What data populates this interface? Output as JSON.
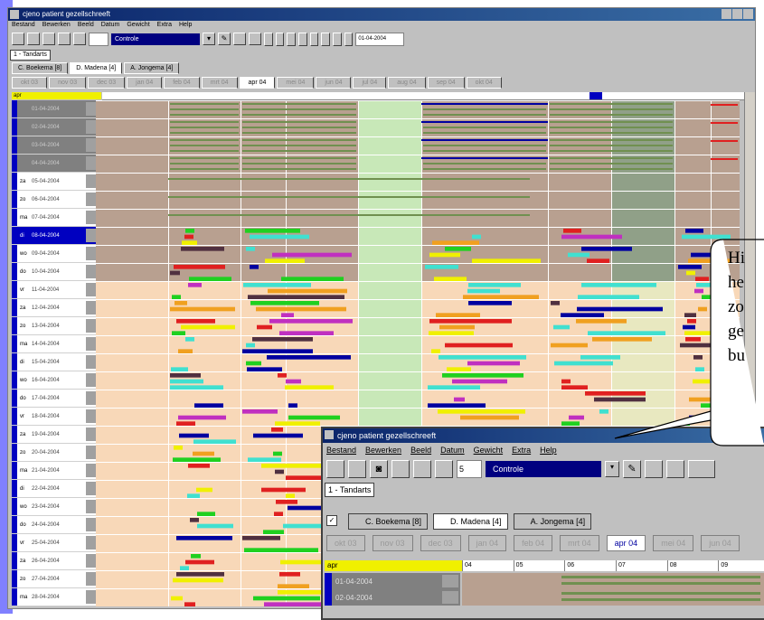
{
  "main": {
    "title": "cjeno patient gezellschreeft",
    "menu": [
      "Bestand",
      "Bewerken",
      "Beeld",
      "Datum",
      "Gewicht",
      "Extra",
      "Help"
    ],
    "combo_value": "Controle",
    "date_value": "01-04-2004",
    "view_tab": "1 - Tandarts",
    "staff_tabs": [
      {
        "label": "C. Boekema [8]",
        "active": false
      },
      {
        "label": "D. Madena [4]",
        "active": true
      },
      {
        "label": "A. Jongema [4]",
        "active": false
      }
    ],
    "months": [
      {
        "label": "okt 03",
        "active": false
      },
      {
        "label": "nov 03",
        "active": false
      },
      {
        "label": "dec 03",
        "active": false
      },
      {
        "label": "jan 04",
        "active": false
      },
      {
        "label": "feb 04",
        "active": false
      },
      {
        "label": "mrt 04",
        "active": false
      },
      {
        "label": "apr 04",
        "active": true
      },
      {
        "label": "mei 04",
        "active": false
      },
      {
        "label": "jun 04",
        "active": false
      },
      {
        "label": "jul 04",
        "active": false
      },
      {
        "label": "aug 04",
        "active": false
      },
      {
        "label": "sep 04",
        "active": false
      },
      {
        "label": "okt 04",
        "active": false
      }
    ],
    "month_header": "apr",
    "rows": [
      {
        "day": "",
        "date": "01-04-2004"
      },
      {
        "day": "",
        "date": "02-04-2004"
      },
      {
        "day": "",
        "date": "03-04-2004"
      },
      {
        "day": "",
        "date": "04-04-2004"
      },
      {
        "day": "za",
        "date": "05-04-2004"
      },
      {
        "day": "zo",
        "date": "06-04-2004"
      },
      {
        "day": "ma",
        "date": "07-04-2004"
      },
      {
        "day": "di",
        "date": "08-04-2004"
      },
      {
        "day": "wo",
        "date": "09-04-2004"
      },
      {
        "day": "do",
        "date": "10-04-2004"
      },
      {
        "day": "vr",
        "date": "11-04-2004"
      },
      {
        "day": "za",
        "date": "12-04-2004"
      },
      {
        "day": "zo",
        "date": "13-04-2004"
      },
      {
        "day": "ma",
        "date": "14-04-2004"
      },
      {
        "day": "di",
        "date": "15-04-2004"
      },
      {
        "day": "wo",
        "date": "16-04-2004"
      },
      {
        "day": "do",
        "date": "17-04-2004"
      },
      {
        "day": "vr",
        "date": "18-04-2004"
      },
      {
        "day": "za",
        "date": "19-04-2004"
      },
      {
        "day": "zo",
        "date": "20-04-2004"
      },
      {
        "day": "ma",
        "date": "21-04-2004"
      },
      {
        "day": "di",
        "date": "22-04-2004"
      },
      {
        "day": "wo",
        "date": "23-04-2004"
      },
      {
        "day": "do",
        "date": "24-04-2004"
      },
      {
        "day": "vr",
        "date": "25-04-2004"
      },
      {
        "day": "za",
        "date": "26-04-2004"
      },
      {
        "day": "zo",
        "date": "27-04-2004"
      },
      {
        "day": "ma",
        "date": "28-04-2004"
      }
    ]
  },
  "zoom": {
    "title": "cjeno patient gezellschreeft",
    "menu": [
      "Bestand",
      "Bewerken",
      "Beeld",
      "Datum",
      "Gewicht",
      "Extra",
      "Help"
    ],
    "spin_value": "5",
    "combo_value": "Controle",
    "view_tab": "1 - Tandarts",
    "staff_tabs": [
      {
        "label": "C. Boekema [8]",
        "active": false
      },
      {
        "label": "D. Madena [4]",
        "active": true
      },
      {
        "label": "A. Jongema [4]",
        "active": false
      }
    ],
    "months": [
      {
        "label": "okt 03",
        "active": false
      },
      {
        "label": "nov 03",
        "active": false
      },
      {
        "label": "dec 03",
        "active": false
      },
      {
        "label": "jan 04",
        "active": false
      },
      {
        "label": "feb 04",
        "active": false
      },
      {
        "label": "mrt 04",
        "active": false
      },
      {
        "label": "apr 04",
        "active": true
      },
      {
        "label": "mei 04",
        "active": false
      },
      {
        "label": "jun 04",
        "active": false
      }
    ],
    "month_header": "apr",
    "col_headers": [
      "04",
      "05",
      "06",
      "07",
      "08",
      "09"
    ],
    "rows": [
      {
        "date": "01-04-2004"
      },
      {
        "date": "02-04-2004"
      }
    ]
  },
  "callout": {
    "lines": [
      "Hi",
      "he",
      "zo",
      "ge",
      "bu"
    ]
  },
  "colors": {
    "grid_tan": "#b8a090",
    "grid_peach": "#f8d8b8",
    "grid_green": "#c8e8b8",
    "bar_navy": "#0000a0",
    "bar_green": "#20d020",
    "bar_magenta": "#c030c0",
    "bar_cyan": "#40e0d0",
    "bar_orange": "#f0a020",
    "bar_maroon": "#503040",
    "bar_olive": "#709050",
    "bar_red": "#e02020",
    "bar_yellow": "#f0f000"
  }
}
